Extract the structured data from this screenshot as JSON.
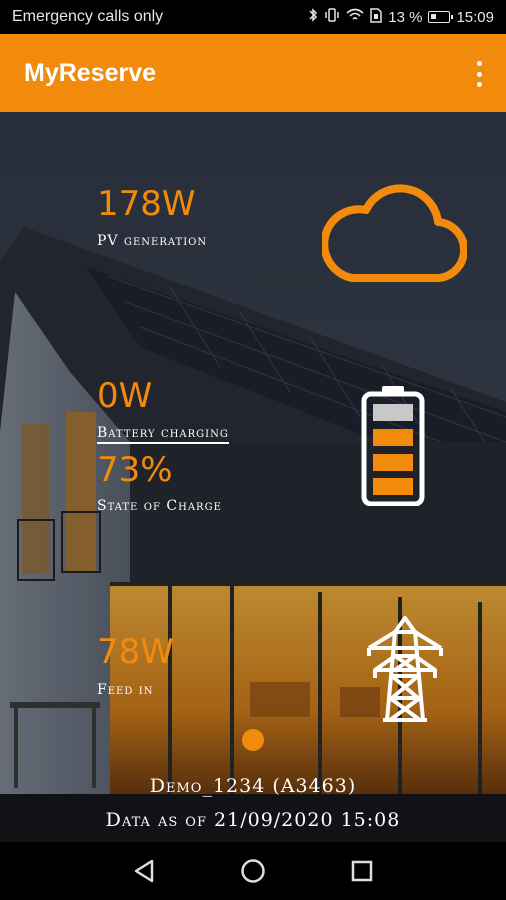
{
  "status_bar": {
    "carrier_text": "Emergency calls only",
    "battery_percent": "13 %",
    "time": "15:09"
  },
  "app_bar": {
    "title": "MyReserve",
    "menu_icon": "more-vert-icon"
  },
  "metrics": {
    "pv": {
      "value": "178W",
      "label": "PV generation",
      "icon": "cloud-icon"
    },
    "battery": {
      "value": "0W",
      "label": "Battery charging",
      "soc_value": "73%",
      "soc_label": "State of Charge",
      "icon": "battery-icon"
    },
    "grid": {
      "value": "78W",
      "label": "Feed in",
      "icon": "power-tower-icon"
    }
  },
  "colors": {
    "accent": "#f28b0c",
    "text": "#ffffff"
  },
  "footer": {
    "device": "Demo_1234 (A3463)",
    "data_time": "Data as of 21/09/2020 15:08"
  },
  "nav_bar": {
    "back_icon": "back-icon",
    "home_icon": "home-icon",
    "recents_icon": "recents-icon"
  }
}
